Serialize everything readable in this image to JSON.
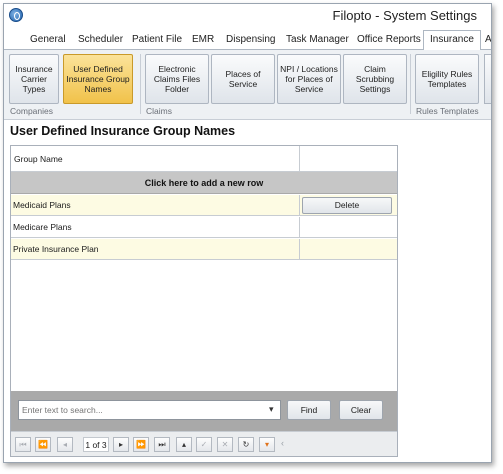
{
  "window": {
    "title": "Filopto - System Settings"
  },
  "tabs": [
    {
      "label": "General",
      "active": false
    },
    {
      "label": "Scheduler",
      "active": false
    },
    {
      "label": "Patient File",
      "active": false
    },
    {
      "label": "EMR",
      "active": false
    },
    {
      "label": "Dispensing",
      "active": false
    },
    {
      "label": "Task Manager",
      "active": false
    },
    {
      "label": "Office Reports",
      "active": false
    },
    {
      "label": "Insurance",
      "active": true
    },
    {
      "label": "A",
      "active": false
    }
  ],
  "ribbon": {
    "buttons": [
      {
        "label": "Insurance Carrier Types",
        "active": false
      },
      {
        "label": "User Defined Insurance Group Names",
        "active": true
      },
      {
        "label": "Electronic Claims Files Folder",
        "active": false
      },
      {
        "label": "Places of Service",
        "active": false
      },
      {
        "label": "NPI / Locations for Places of Service",
        "active": false
      },
      {
        "label": "Claim Scrubbing Settings",
        "active": false
      },
      {
        "label": "Eligility Rules Templates",
        "active": false
      }
    ],
    "groups": [
      {
        "label": "Companies"
      },
      {
        "label": "Claims"
      },
      {
        "label": "Rules Templates"
      }
    ]
  },
  "page": {
    "title": "User Defined Insurance Group Names"
  },
  "grid": {
    "column_header": "Group Name",
    "add_row_label": "Click here to add a new row",
    "rows": [
      {
        "name": "Medicaid Plans",
        "delete_label": "Delete"
      },
      {
        "name": "Medicare Plans"
      },
      {
        "name": "Private Insurance Plan"
      }
    ]
  },
  "search": {
    "placeholder": "Enter text to search...",
    "find_label": "Find",
    "clear_label": "Clear"
  },
  "navigator": {
    "page_info": "1 of 3",
    "first_icon": "first-page-icon",
    "prev_page_icon": "previous-page-icon",
    "prev_icon": "previous-record-icon",
    "next_icon": "next-record-icon",
    "next_page_icon": "next-page-icon",
    "last_icon": "last-page-icon",
    "colors": {
      "filter": "#e0731c",
      "active_ribbon": "#f1c24a",
      "add_row_bg": "#c6c6c6",
      "alt_row_bg": "#fdfbe3"
    }
  }
}
